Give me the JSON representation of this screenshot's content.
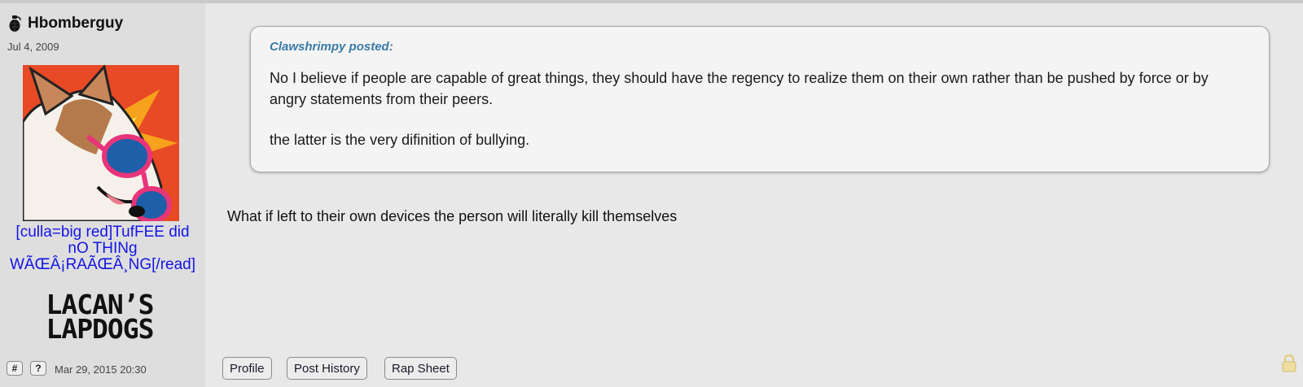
{
  "author": {
    "name": "Hbomberguy",
    "reg_date": "Jul 4, 2009",
    "title_lines": [
      "[culla=big red]TufFEE did",
      "nO THINg",
      "WÃŒÂ¡RAÃŒÂ¸NG[/read]"
    ],
    "banner_lines": [
      "LACAN’S",
      "LAPDOGS"
    ]
  },
  "quote": {
    "author": "Clawshrimpy posted:",
    "paragraphs": [
      "No I believe if people are capable of great things, they should have the regency to realize them on their own rather than be pushed by force or by angry statements from their peers.",
      "the latter is the very difinition of bullying."
    ]
  },
  "reply_text": "What if left to their own devices the person will literally kill themselves",
  "footer": {
    "hash_label": "#",
    "question_label": "?",
    "post_date": "Mar 29, 2015 20:30",
    "buttons": [
      "Profile",
      "Post History",
      "Rap Sheet"
    ]
  },
  "icons": {
    "author_badge": "grenade-icon",
    "post_lock": "lock-icon"
  },
  "colors": {
    "quote_author": "#3a7aa6",
    "user_title": "#1414e6",
    "sidebar_bg": "#dedede",
    "post_bg": "#e8e8e8"
  }
}
